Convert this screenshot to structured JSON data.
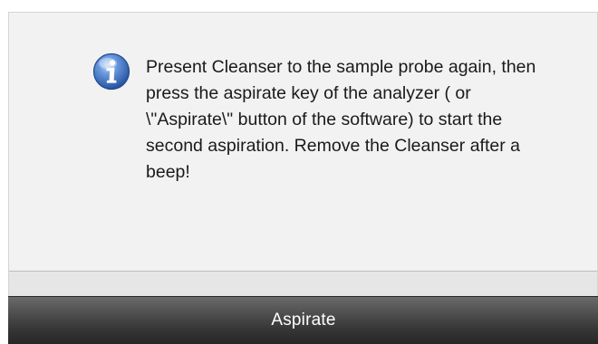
{
  "dialog": {
    "icon": "info-icon",
    "message": "Present  Cleanser to the sample probe again, then press the aspirate key of the analyzer ( or \\\"Aspirate\\\" button of the software) to start the second aspiration. Remove the Cleanser after a beep!",
    "accent_color": "#3b6fc4"
  },
  "actions": {
    "aspirate_label": "Aspirate"
  }
}
